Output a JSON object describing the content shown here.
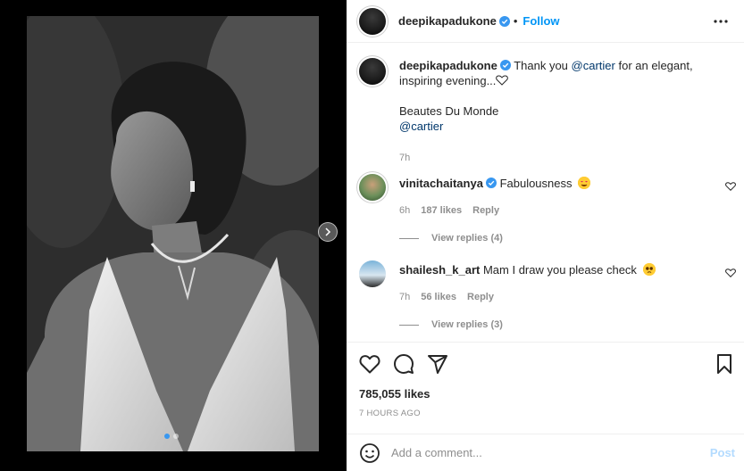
{
  "post": {
    "author": "deepikapadukone",
    "follow_label": "Follow",
    "caption_line1": "Thank you ",
    "caption_mention1": "@cartier",
    "caption_line1_rest": " for an elegant, inspiring evening...",
    "caption_line2": "Beautes Du Monde",
    "caption_mention2": "@cartier",
    "caption_time": "7h",
    "media_slide_count": 2,
    "media_active_slide": 1
  },
  "comments": [
    {
      "username": "vinitachaitanya",
      "verified": true,
      "text": "Fabulousness",
      "emoji": "heart-eyes-emoji",
      "time": "6h",
      "likes": "187 likes",
      "reply_label": "Reply",
      "view_replies": "View replies (4)"
    },
    {
      "username": "shailesh_k_art",
      "verified": false,
      "text": "Mam I draw you please check",
      "emoji": "pleading-face-emoji",
      "time": "7h",
      "likes": "56 likes",
      "reply_label": "Reply",
      "view_replies": "View replies (3)"
    }
  ],
  "stats": {
    "likes": "785,055 likes",
    "timestamp": "7 HOURS AGO"
  },
  "add_comment": {
    "placeholder": "Add a comment...",
    "post_label": "Post"
  },
  "colors": {
    "accent": "#0095f6",
    "verified": "#3897f0",
    "mention": "#00376b",
    "muted": "#8e8e8e",
    "post_disabled": "#b3dbff"
  },
  "icons": {
    "more": "more-horizontal-icon",
    "like": "heart-icon",
    "comment": "comment-bubble-icon",
    "share": "paper-plane-icon",
    "save": "bookmark-icon",
    "emoji": "smiley-icon",
    "next": "chevron-right-icon"
  }
}
